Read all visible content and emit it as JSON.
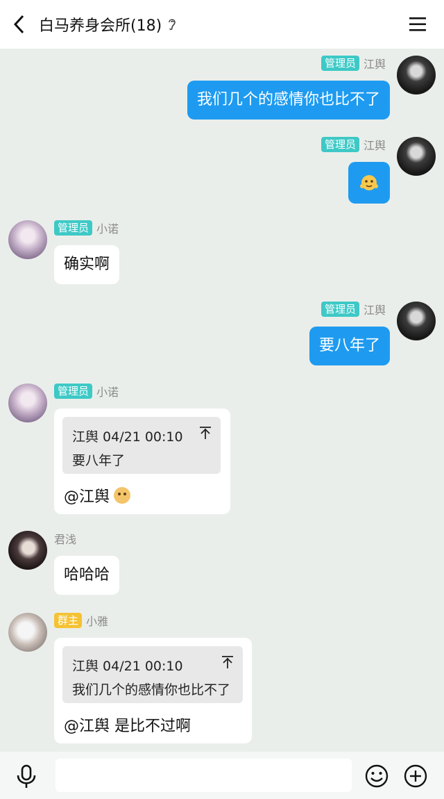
{
  "header": {
    "title": "白马养身会所(18)",
    "back_icon": "chevron-left-icon",
    "ear_icon": "ear-icon",
    "menu_icon": "menu-icon"
  },
  "messages": [
    {
      "side": "right",
      "role": "管理员",
      "sender": "江舆",
      "text": "我们几个的感情你也比不了"
    },
    {
      "side": "right",
      "role": "管理员",
      "sender": "江舆",
      "text": "",
      "emoji": "emoji-sticker"
    },
    {
      "side": "left",
      "role": "管理员",
      "sender": "小诺",
      "text": "确实啊"
    },
    {
      "side": "right",
      "role": "管理员",
      "sender": "江舆",
      "text": "要八年了"
    },
    {
      "side": "left",
      "role": "管理员",
      "sender": "小诺",
      "quote": {
        "meta": "江舆 04/21 00:10",
        "text": "要八年了"
      },
      "reply": "@江舆",
      "reply_emoji": "emoji-face"
    },
    {
      "side": "left",
      "role": "",
      "sender": "君浅",
      "text": "哈哈哈"
    },
    {
      "side": "left",
      "role": "群主",
      "sender": "小雅",
      "quote": {
        "meta": "江舆 04/21 00:10",
        "text": "我们几个的感情你也比不了"
      },
      "reply": "@江舆 是比不过啊"
    }
  ],
  "composer": {
    "placeholder": "",
    "value": "",
    "mic_icon": "mic-icon",
    "emoji_icon": "smile-icon",
    "plus_icon": "plus-icon"
  },
  "colors": {
    "my_bubble": "#1e9bf0",
    "admin_badge": "#3ec9c6",
    "owner_badge": "#f5c233",
    "background": "#eaeeeb"
  }
}
